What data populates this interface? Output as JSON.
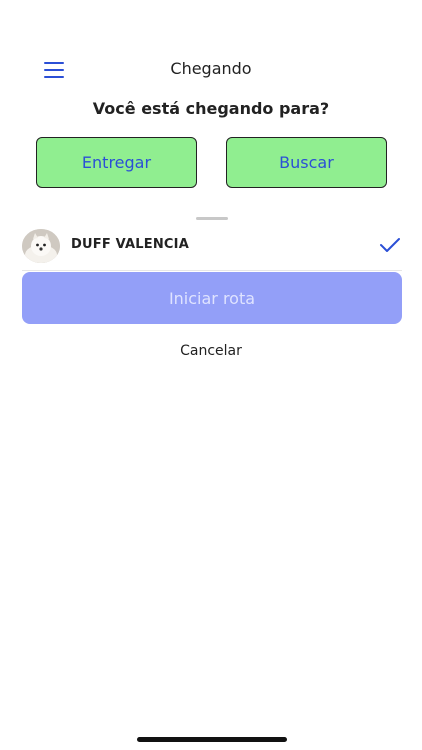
{
  "header": {
    "title": "Chegando",
    "menu_icon": "hamburger-menu-icon",
    "accent_color": "#2b4fd6"
  },
  "prompt": {
    "question": "Você está chegando para?"
  },
  "choices": {
    "deliver_label": "Entregar",
    "pickup_label": "Buscar",
    "button_color": "#90ee90"
  },
  "recipient": {
    "name": "DUFF VALENCIA",
    "selected": true,
    "avatar_icon": "dog-avatar",
    "check_icon": "check-icon"
  },
  "actions": {
    "start_route_label": "Iniciar rota",
    "start_route_color": "#939ff8",
    "cancel_label": "Cancelar"
  }
}
